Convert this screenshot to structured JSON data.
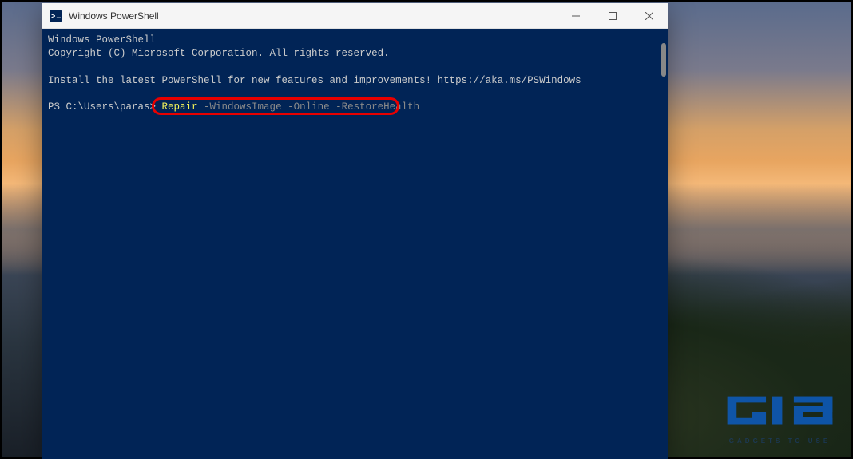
{
  "window": {
    "title": "Windows PowerShell",
    "controls": {
      "minimize": "minimize",
      "maximize": "maximize",
      "close": "close"
    }
  },
  "terminal": {
    "banner_line1": "Windows PowerShell",
    "banner_line2": "Copyright (C) Microsoft Corporation. All rights reserved.",
    "install_msg": "Install the latest PowerShell for new features and improvements! https://aka.ms/PSWindows",
    "prompt": "PS C:\\Users\\paras> ",
    "command_main": "Repair",
    "command_args": " -WindowsImage -Online -RestoreHealth"
  },
  "watermark": {
    "text": "GADGETS TO USE"
  },
  "colors": {
    "terminal_bg": "#012456",
    "highlight_border": "#e80000",
    "cmd_keyword": "#f5f55a",
    "cmd_param": "#8a8a8a",
    "watermark_blue": "#0d5fc9"
  }
}
